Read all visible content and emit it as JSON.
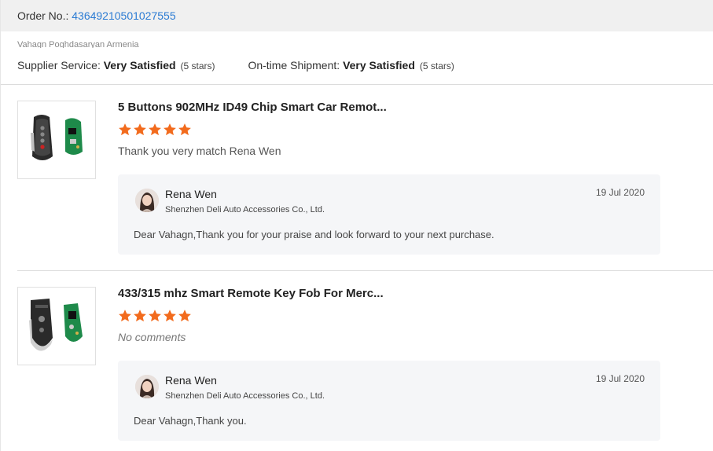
{
  "order": {
    "label": "Order No.: ",
    "number": "43649210501027555"
  },
  "cut_off_text": "Vahagn Poghdasaryan Armenia",
  "ratings": {
    "supplier_service": {
      "label": "Supplier Service: ",
      "value": "Very Satisfied",
      "stars_text": "(5 stars)"
    },
    "on_time_shipment": {
      "label": "On-time Shipment: ",
      "value": "Very Satisfied",
      "stars_text": "(5 stars)"
    }
  },
  "colors": {
    "star": "#f26b1d",
    "link": "#2b7bd3",
    "reply_bg": "#f5f6f8"
  },
  "reviews": [
    {
      "title": "5 Buttons 902MHz ID49 Chip Smart Car Remot...",
      "stars": 5,
      "comment": "Thank you very match Rena Wen",
      "reply": {
        "seller_name": "Rena Wen",
        "company": "Shenzhen Deli Auto Accessories Co., Ltd.",
        "date": "19 Jul 2020",
        "text": "Dear Vahagn,Thank you for your praise and look forward to your next purchase."
      }
    },
    {
      "title": "433/315 mhz Smart Remote Key Fob For Merc...",
      "stars": 5,
      "comment": "No comments",
      "reply": {
        "seller_name": "Rena Wen",
        "company": "Shenzhen Deli Auto Accessories Co., Ltd.",
        "date": "19 Jul 2020",
        "text": "Dear Vahagn,Thank you."
      }
    }
  ]
}
